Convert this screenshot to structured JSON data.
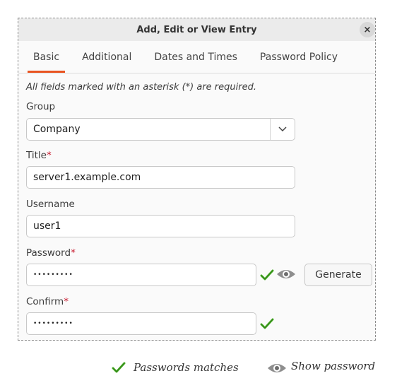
{
  "dialog": {
    "title": "Add, Edit or View Entry",
    "close_glyph": "×"
  },
  "tabs": [
    {
      "label": "Basic",
      "active": true
    },
    {
      "label": "Additional",
      "active": false
    },
    {
      "label": "Dates and Times",
      "active": false
    },
    {
      "label": "Password Policy",
      "active": false
    }
  ],
  "form": {
    "required_note": "All fields marked with an asterisk (*) are required.",
    "group": {
      "label": "Group",
      "value": "Company"
    },
    "title": {
      "label": "Title",
      "required_mark": "*",
      "value": "server1.example.com"
    },
    "username": {
      "label": "Username",
      "value": "user1"
    },
    "password": {
      "label": "Password",
      "required_mark": "*",
      "value": "•••••••••",
      "generate_label": "Generate"
    },
    "confirm": {
      "label": "Confirm",
      "required_mark": "*",
      "value": "•••••••••"
    }
  },
  "legend": {
    "match_text": "Passwords matches",
    "show_text": "Show password"
  },
  "icons": {
    "match": "checkmark-icon",
    "show": "eye-icon",
    "dropdown": "chevron-down-icon",
    "close": "close-icon"
  },
  "colors": {
    "accent": "#e95420",
    "required": "#c7162b",
    "check": "#4caf2a"
  }
}
